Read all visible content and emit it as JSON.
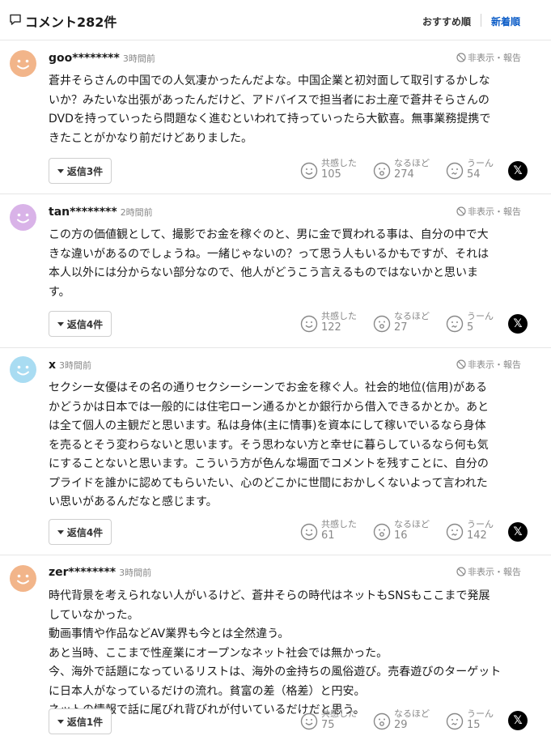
{
  "header": {
    "title": "コメント282件",
    "sort_recommended": "おすすめ順",
    "sort_newest": "新着順"
  },
  "hide_report_label": "非表示・報告",
  "reactions": {
    "agree": "共感した",
    "insight": "なるほど",
    "hmm": "うーん"
  },
  "comments": [
    {
      "user": "goo********",
      "time": "3時間前",
      "avatar_color": "#f2b58a",
      "lines": [
        "蒼井そらさんの中国での人気凄かったんだよな。中国企業と初対面して取引するかしな",
        "いか？みたいな出張があったんだけど、アドバイスで担当者にお土産で蒼井そらさんの",
        "DVDを持っていったら問題なく進むといわれて持っていったら大歓喜。無事業務提携で",
        "きたことがかなり前だけどありました。"
      ],
      "reply": "返信3件",
      "agree": "105",
      "insight": "274",
      "hmm": "54"
    },
    {
      "user": "tan********",
      "time": "2時間前",
      "avatar_color": "#d9b3e8",
      "lines": [
        "この方の価値観として、撮影でお金を稼ぐのと、男に金で買われる事は、自分の中で大",
        "きな違いがあるのでしょうね。一緒じゃないの？って思う人もいるかもですが、それは",
        "本人以外には分からない部分なので、他人がどうこう言えるものではないかと思いま",
        "す。"
      ],
      "reply": "返信4件",
      "agree": "122",
      "insight": "27",
      "hmm": "5"
    },
    {
      "user": "x",
      "time": "3時間前",
      "avatar_color": "#a9dcf2",
      "lines": [
        "セクシー女優はその名の通りセクシーシーンでお金を稼ぐ人。社会的地位(信用)がある",
        "かどうかは日本では一般的には住宅ローン通るかとか銀行から借入できるかとか。あと",
        "は全て個人の主観だと思います。私は身体(主に情事)を資本にして稼いでいるなら身体",
        "を売るとそう変わらないと思います。そう思わない方と幸せに暮らしているなら何も気",
        "にすることないと思います。こういう方が色んな場面でコメントを残すことに、自分の",
        "プライドを誰かに認めてもらいたい、心のどこかに世間におかしくないよって言われた",
        "い思いがあるんだなと感じます。"
      ],
      "reply": "返信4件",
      "agree": "61",
      "insight": "16",
      "hmm": "142"
    },
    {
      "user": "zer********",
      "time": "3時間前",
      "avatar_color": "#f2b58a",
      "lines": [
        "時代背景を考えられない人がいるけど、蒼井そらの時代はネットもSNSもここまで発展",
        "していなかった。",
        "動画事情や作品などAV業界も今とは全然違う。",
        "あと当時、ここまで性産業にオープンなネット社会では無かった。",
        "今、海外で話題になっているリストは、海外の金持ちの風俗遊び。売春遊びのターゲット",
        "に日本人がなっているだけの流れ。貧富の差（格差）と円安。",
        "ネットの情報で話に尾びれ背びれが付いているだけだと思う。"
      ],
      "reply": "返信1件",
      "agree": "75",
      "insight": "29",
      "hmm": "15"
    }
  ]
}
